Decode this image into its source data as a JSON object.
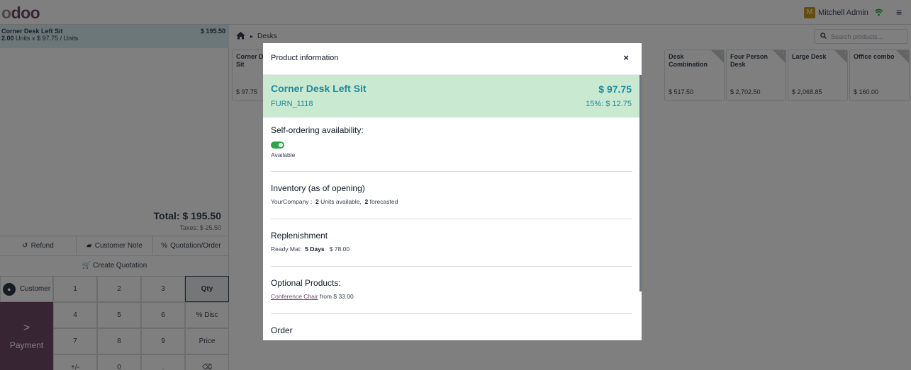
{
  "header": {
    "logo_o1": "o",
    "logo_rest": "doo",
    "user_initial": "M",
    "user_name": "Mitchell Admin",
    "menu_glyph": "≡"
  },
  "order": {
    "line_name": "Corner Desk Left Sit",
    "line_qty": "2.00",
    "line_unit_text": "Units x $ 97.75 / Units",
    "line_price": "$ 195.50",
    "total": "Total: $ 195.50",
    "taxes": "Taxes: $ 25.50"
  },
  "actions": {
    "refund": "Refund",
    "customer_note": "Customer Note",
    "quotation_order": "Quotation/Order",
    "create_quotation": "Create Quotation"
  },
  "numpad": {
    "customer": "Customer",
    "payment": "Payment",
    "k1": "1",
    "k2": "2",
    "k3": "3",
    "k4": "4",
    "k5": "5",
    "k6": "6",
    "k7": "7",
    "k8": "8",
    "k9": "9",
    "kpm": "+/-",
    "k0": "0",
    "kdot": ".",
    "qty": "Qty",
    "disc": "% Disc",
    "price": "Price",
    "back": "⌫"
  },
  "products": {
    "breadcrumb": "Desks",
    "search_placeholder": "Search products...",
    "cards": [
      {
        "name": "Corner Desk Left Sit",
        "price": "$ 97.75"
      },
      {
        "name": "Desk Combination",
        "price": "$ 517.50"
      },
      {
        "name": "Four Person Desk",
        "price": "$ 2,702.50"
      },
      {
        "name": "Large Desk",
        "price": "$ 2,068.85"
      },
      {
        "name": "Office combo",
        "price": "$ 160.00"
      }
    ]
  },
  "modal": {
    "title": "Product information",
    "close": "×",
    "product_name": "Corner Desk Left Sit",
    "product_code": "FURN_1118",
    "product_price": "$ 97.75",
    "product_tax": "15%: $ 12.75",
    "self_order_title": "Self-ordering availability:",
    "self_order_status": "Available",
    "inventory_title": "Inventory (as of opening)",
    "inventory_company": "YourCompany :",
    "inventory_available_qty": "2",
    "inventory_available_label": "Units available,",
    "inventory_forecast_qty": "2",
    "inventory_forecast_label": "forecasted",
    "replenishment_title": "Replenishment",
    "replenishment_vendor": "Ready Mat:",
    "replenishment_lead": "5 Days",
    "replenishment_price": "$ 78.00",
    "optional_title": "Optional Products:",
    "optional_link": "Conference Chair",
    "optional_from": "from $ 33.00",
    "order_title": "Order"
  },
  "colors": {
    "brand": "#714b67",
    "accent": "#1f8a9c",
    "success": "#28a745",
    "product_header_bg": "#c9e9d1"
  }
}
